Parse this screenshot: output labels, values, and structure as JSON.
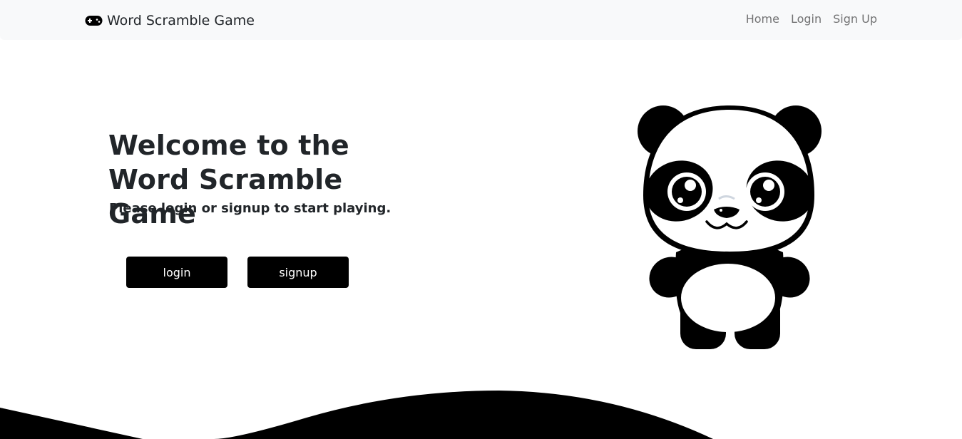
{
  "navbar": {
    "brand_icon": "gamepad-icon",
    "brand_text": "Word Scramble Game",
    "links": [
      {
        "label": "Home"
      },
      {
        "label": "Login"
      },
      {
        "label": "Sign Up"
      }
    ]
  },
  "hero": {
    "title": "Welcome to the Word Scramble Game",
    "subtitle": "Please login or signup to start playing.",
    "login_label": "login",
    "signup_label": "signup"
  },
  "illustration": {
    "name": "panda-illustration"
  },
  "colors": {
    "navbar_bg": "#f8f9fa",
    "button_bg": "#000000",
    "button_text": "#ffffff",
    "wave": "#000000",
    "text": "#212529",
    "nav_link": "#8c8c8c"
  }
}
